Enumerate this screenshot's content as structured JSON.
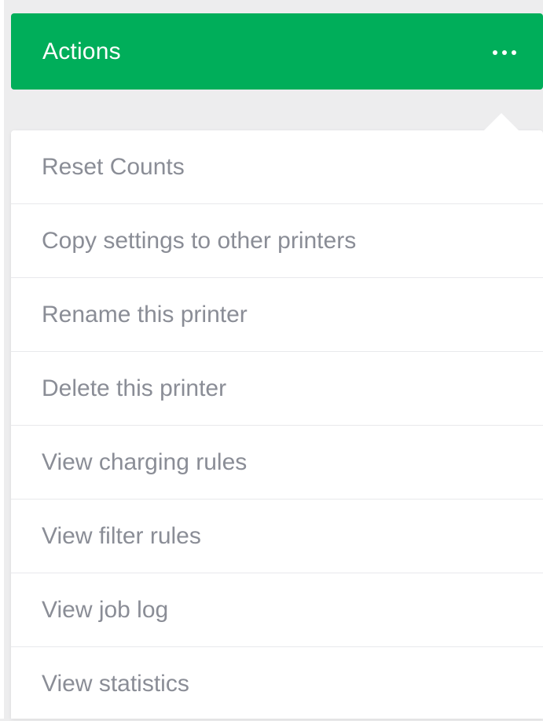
{
  "header": {
    "title": "Actions",
    "more_icon": "more-horizontal-icon",
    "color": "#00ae5a"
  },
  "menu": {
    "items": [
      "Reset Counts",
      "Copy settings to other printers",
      "Rename this printer",
      "Delete this printer",
      "View charging rules",
      "View filter rules",
      "View job log",
      "View statistics"
    ],
    "text_color": "#8a8d96"
  }
}
